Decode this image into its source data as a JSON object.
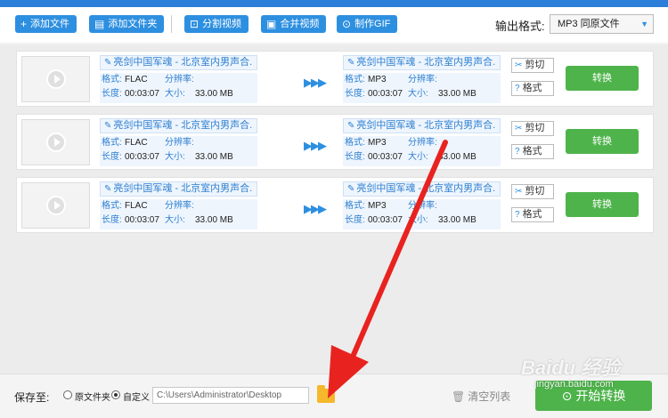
{
  "toolbar": {
    "add_file": "添加文件",
    "add_folder": "添加文件夹",
    "split_video": "分割视频",
    "merge_video": "合并视频",
    "make_gif": "制作GIF",
    "output_label": "输出格式:",
    "output_value": "MP3  同原文件"
  },
  "labels": {
    "format": "格式:",
    "resolution": "分辨率:",
    "duration": "长度:",
    "size": "大小:",
    "cut": "剪切",
    "format_btn": "格式",
    "convert": "转换"
  },
  "rows": [
    {
      "source_name": "亮剑中国军魂 - 北京室内男声合.",
      "source_format": "FLAC",
      "source_duration": "00:03:07",
      "source_size": "33.00 MB",
      "target_name": "亮剑中国军魂 - 北京室内男声合.",
      "target_format": "MP3",
      "target_duration": "00:03:07",
      "target_size": "33.00 MB"
    },
    {
      "source_name": "亮剑中国军魂 - 北京室内男声合.",
      "source_format": "FLAC",
      "source_duration": "00:03:07",
      "source_size": "33.00 MB",
      "target_name": "亮剑中国军魂 - 北京室内男声合.",
      "target_format": "MP3",
      "target_duration": "00:03:07",
      "target_size": "33.00 MB"
    },
    {
      "source_name": "亮剑中国军魂 - 北京室内男声合.",
      "source_format": "FLAC",
      "source_duration": "00:03:07",
      "source_size": "33.00 MB",
      "target_name": "亮剑中国军魂 - 北京室内男声合.",
      "target_format": "MP3",
      "target_duration": "00:03:07",
      "target_size": "33.00 MB"
    }
  ],
  "bottom": {
    "save_to": "保存至:",
    "original_folder": "原文件夹",
    "custom": "自定义",
    "path": "C:\\Users\\Administrator\\Desktop",
    "clear_list": "清空列表",
    "start": "开始转换"
  },
  "watermark": {
    "brand": "Baidu 经验",
    "url": "jingyan.baidu.com"
  },
  "colors": {
    "accent": "#2d8fe0",
    "convert_green": "#4eb34b",
    "annotation_arrow": "#e8231f"
  }
}
